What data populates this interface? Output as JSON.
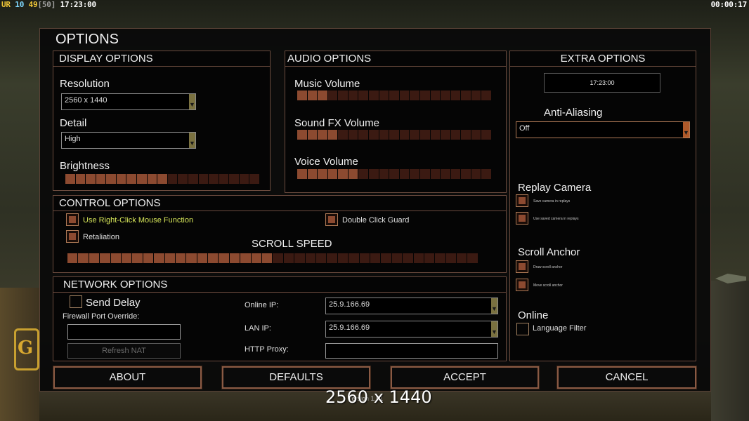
{
  "hud": {
    "ur": "UR",
    "n10": "10",
    "n49": "49",
    "bracket": "[50]",
    "time": "17:23:00",
    "timer": "00:00:17"
  },
  "window": {
    "title": "OPTIONS"
  },
  "display": {
    "header": "DISPLAY OPTIONS",
    "resolution_label": "Resolution",
    "resolution_value": "2560 x 1440",
    "detail_label": "Detail",
    "detail_value": "High",
    "brightness_label": "Brightness",
    "brightness": {
      "segments": 19,
      "filled": 10
    }
  },
  "audio": {
    "header": "AUDIO OPTIONS",
    "music_label": "Music Volume",
    "music": {
      "segments": 19,
      "filled": 3
    },
    "sfx_label": "Sound FX Volume",
    "sfx": {
      "segments": 19,
      "filled": 4
    },
    "voice_label": "Voice Volume",
    "voice": {
      "segments": 19,
      "filled": 6
    }
  },
  "extra": {
    "header": "EXTRA OPTIONS",
    "clock": "17:23:00",
    "aa_label": "Anti-Aliasing",
    "aa_value": "Off",
    "replay_camera_label": "Replay Camera",
    "save_camera": "Save camera in replays",
    "use_saved_camera": "Use saved camera in replays",
    "scroll_anchor_label": "Scroll Anchor",
    "draw_scroll_anchor": "Draw scroll anchor",
    "move_scroll_anchor": "Move scroll anchor",
    "online_label": "Online",
    "language_filter": "Language Filter"
  },
  "control": {
    "header": "CONTROL OPTIONS",
    "right_click": "Use Right-Click Mouse Function",
    "double_click": "Double Click Guard",
    "retaliation": "Retaliation",
    "scroll_speed_label": "SCROLL SPEED",
    "scroll_speed": {
      "segments": 38,
      "filled": 19
    }
  },
  "network": {
    "header": "NETWORK OPTIONS",
    "send_delay": "Send Delay",
    "firewall_label": "Firewall Port Override:",
    "firewall_value": "",
    "refresh_nat": "Refresh NAT",
    "online_ip_label": "Online IP:",
    "online_ip_value": "25.9.166.69",
    "lan_ip_label": "LAN IP:",
    "lan_ip_value": "25.9.166.69",
    "http_proxy_label": "HTTP Proxy:",
    "http_proxy_value": ""
  },
  "buttons": {
    "about": "ABOUT",
    "defaults": "DEFAULTS",
    "accept": "ACCEPT",
    "cancel": "CANCEL"
  },
  "overlay": {
    "resolution": "2560 x 1440",
    "version": "Version 1.51"
  },
  "colors": {
    "accent_border": "#6b4b3e",
    "slider_on": "#8c4a30",
    "slider_off": "#3b1a12",
    "highlight_text": "#d8e85a"
  }
}
